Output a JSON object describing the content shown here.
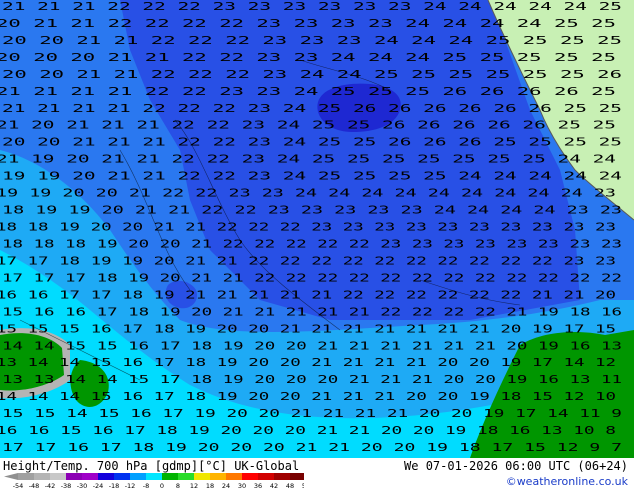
{
  "title": {
    "left": "Height/Temp. 700 hPa [gdmp][°C] UK-Global",
    "right": "We 07-01-2026 06:00 UTC (06+24)",
    "credit": "©weatheronline.co.uk"
  },
  "legend": {
    "ticks": [
      "-54",
      "-48",
      "-42",
      "-38",
      "-30",
      "-24",
      "-18",
      "-12",
      "-8",
      "0",
      "8",
      "12",
      "18",
      "24",
      "30",
      "36",
      "42",
      "48",
      "54"
    ],
    "colors": [
      "#a0a0a0",
      "#b4b4b4",
      "#c8c8c8",
      "#8c00b4",
      "#a000c8",
      "#1400dc",
      "#0032f0",
      "#00a0ff",
      "#00e6ff",
      "#00b400",
      "#28dc28",
      "#f0e600",
      "#ffb400",
      "#ff7800",
      "#ff0000",
      "#d20000",
      "#a00000",
      "#780000"
    ]
  },
  "map": {
    "colors": {
      "deep_blue": "#1e28d2",
      "blue": "#2850e6",
      "mid_blue": "#2a78f0",
      "light_blue": "#1eaaf5",
      "cyan": "#00dcff",
      "green": "#009600",
      "land": "#c8f0b4",
      "grey": "#b4b4b4",
      "contour": "#000000"
    },
    "isotherm_rows": [
      "21 21 21 22 22 22 23 23 23 23 23 23 24 24 24 24 24 25",
      "20 21 21 22 22 22 22 23 23 23 23 24 24 24 24 25 25",
      "20 20 21 21 22 22 22 23 23 23 24 24 24 25 25 25 25",
      "20 20 20 21 21 22 22 23 23 24 24 24 25 25 25 25 25",
      "20 20 21 21 22 22 22 23 24 24 25 25 25 25 25 25 26",
      "21 21 21 21 22 22 23 23 24 25 25 25 26 26 26 26 25",
      "21 21 21 21 22 22 22 23 24 25 26 26 26 26 26 26 25 25",
      "21 20 21 21 21 22 22 23 24 25 25 26 26 26 26 26 25 25",
      "20 20 21 21 21 22 22 23 24 25 25 26 26 26 25 25 25 25",
      "21 19 20 21 21 22 22 23 24 25 25 25 25 25 25 25 24 24",
      "19 19 20 21 21 22 22 23 24 25 25 25 25 24 24 24 24 24",
      "19 19 20 20 21 22 22 23 23 24 24 24 24 24 24 24 24 24 23",
      "18 19 19 20 21 21 22 22 23 23 23 23 23 24 24 24 24 23 23",
      "18 18 19 20 20 21 21 22 22 22 23 23 23 23 23 23 23 23 23 23",
      "18 18 18 19 20 20 21 22 22 22 22 22 23 23 23 23 23 23 23 23",
      "17 17 18 19 19 20 21 21 22 22 22 22 22 22 22 22 22 22 23 23",
      "17 17 17 18 19 20 21 21 22 22 22 22 22 22 22 22 22 22 22 22",
      "16 16 17 17 18 19 21 21 21 21 21 22 22 22 22 22 22 21 21 20",
      "15 16 16 17 18 19 20 21 21 21 21 21 22 22 22 22 21 19 18 16",
      "15 15 15 16 17 18 19 20 20 21 21 21 21 21 21 21 20 19 17 15",
      "14 14 15 15 16 17 18 19 20 20 21 21 21 21 21 21 20 19 16 13",
      "13 14 14 15 16 17 18 19 20 20 21 21 21 21 20 20 19 17 14 12",
      "13 13 14 14 15 17 18 19 20 20 20 21 21 21 20 20 19 16 13 11",
      "14 14 14 15 16 17 18 19 20 20 21 21 21 20 20 19 18 15 12 10",
      "15 15 14 15 16 17 19 20 20 21 21 21 21 20 20 19 17 14 11 9",
      "16 16 15 16 17 18 19 20 20 20 21 21 20 20 19 18 16 13 10 8",
      "17 17 16 17 18 19 20 20 20 21 21 20 20 19 18 17 15 12 9 7"
    ]
  }
}
